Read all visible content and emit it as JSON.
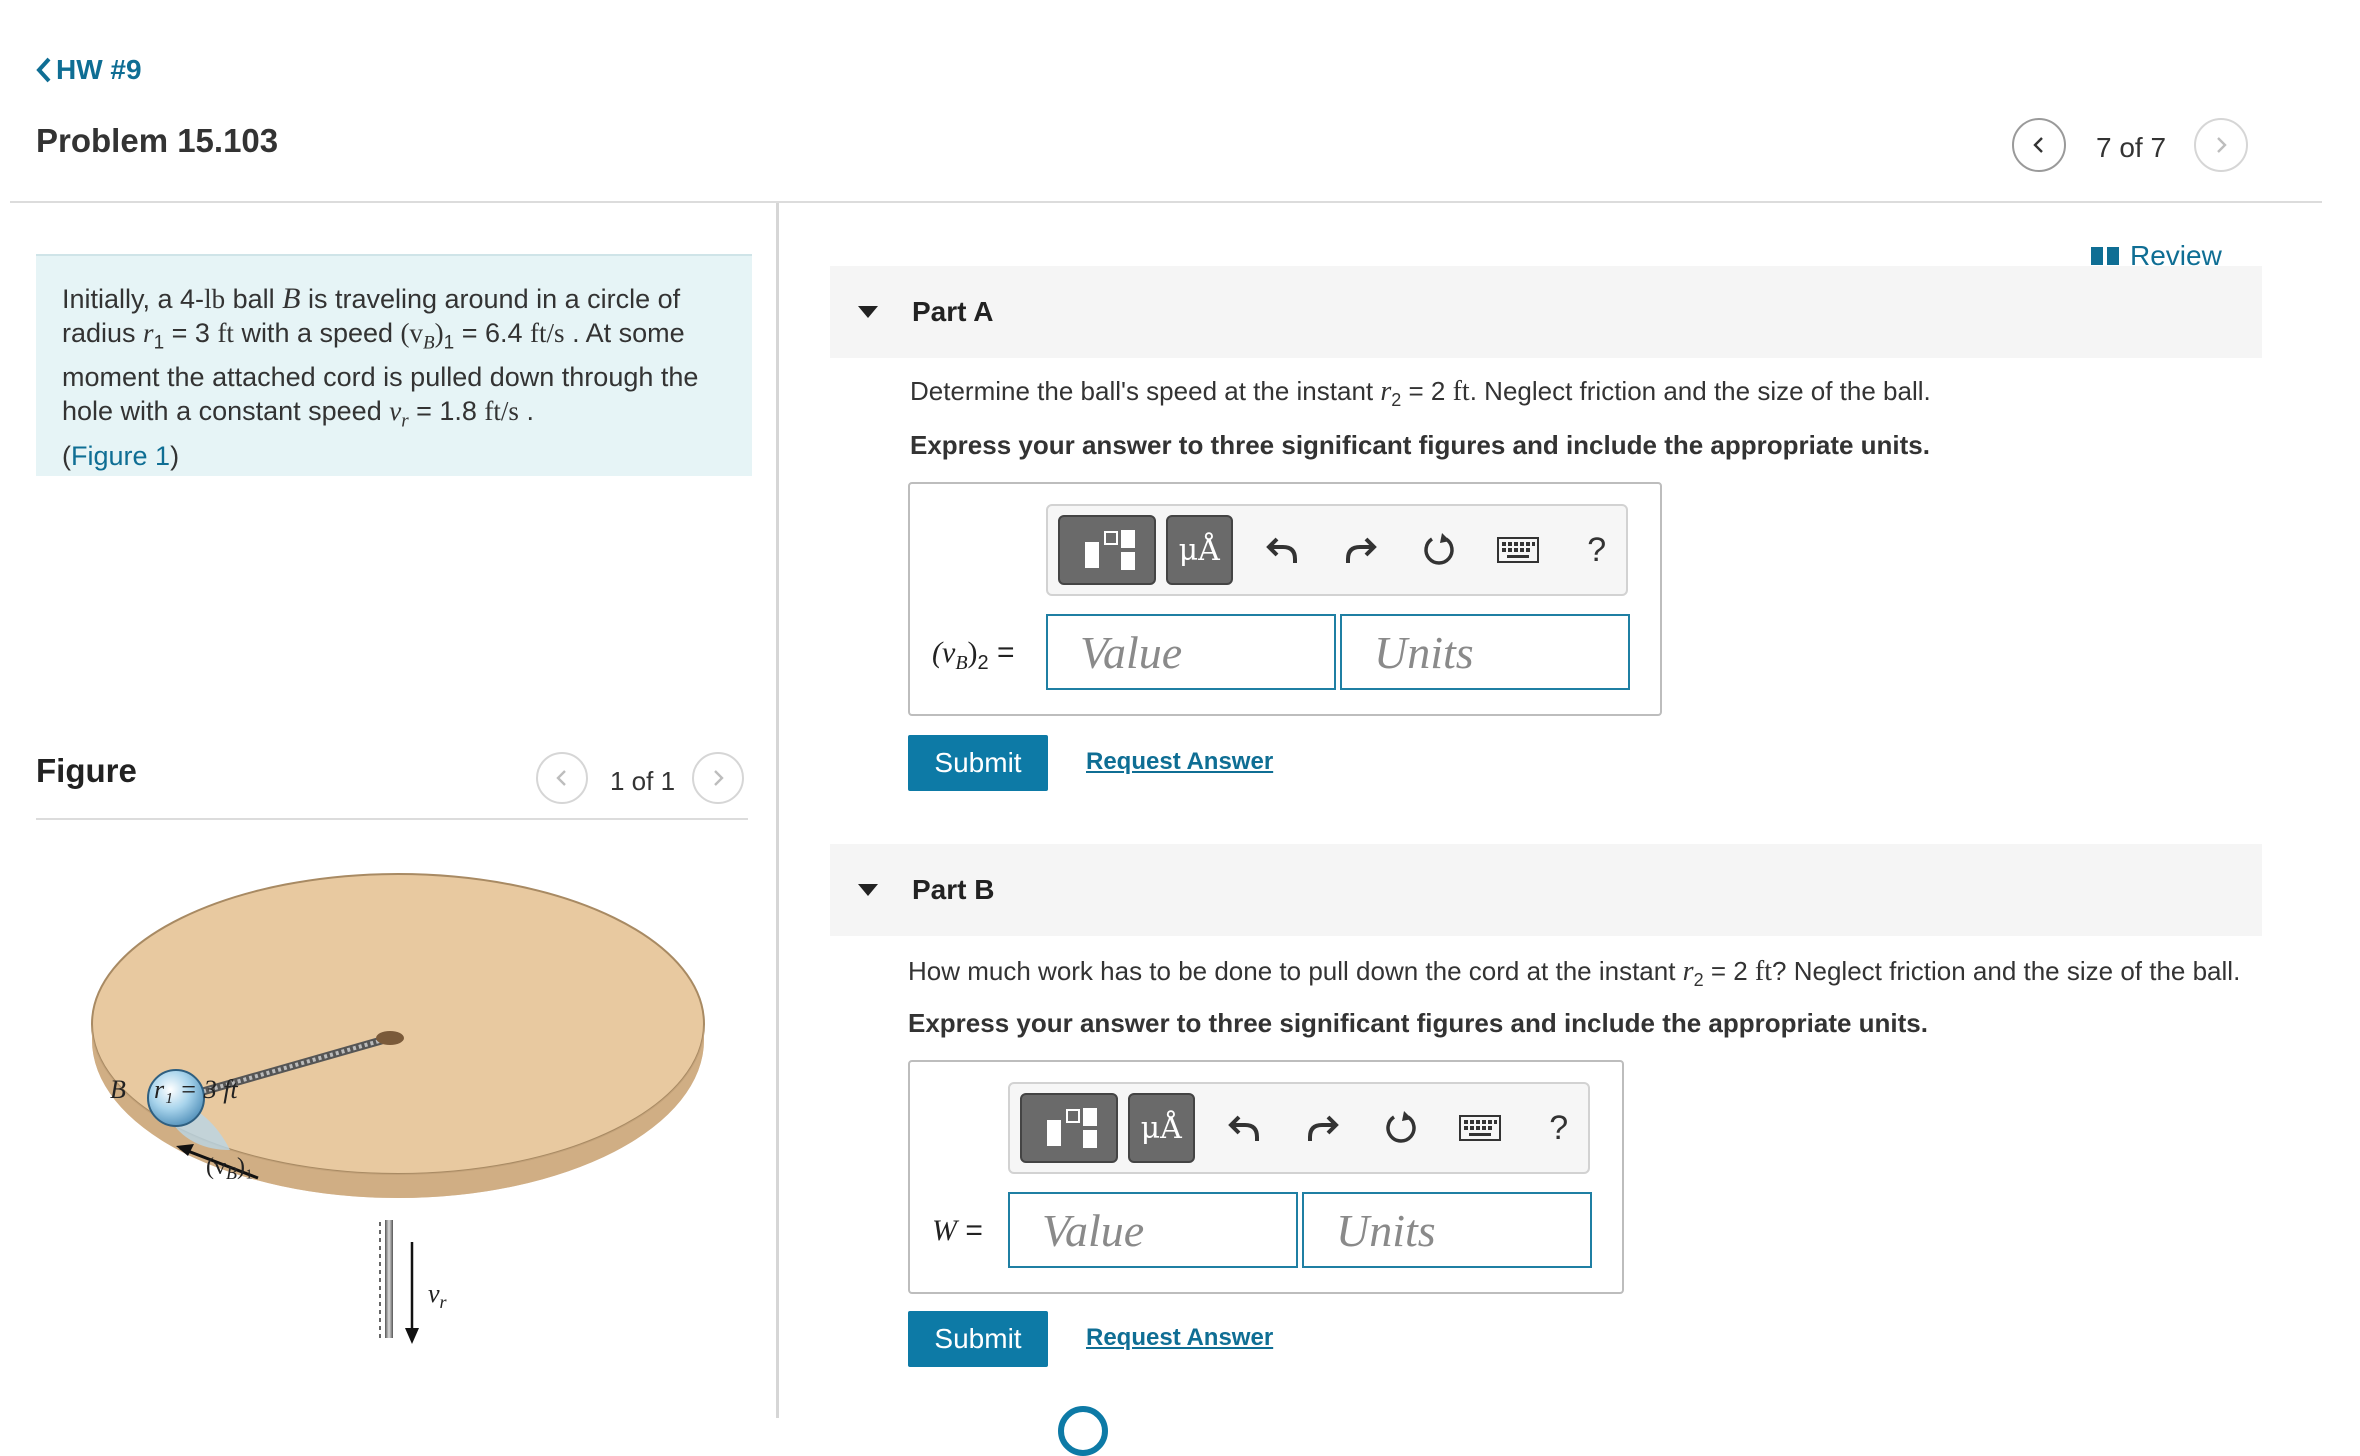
{
  "nav": {
    "back_label": "HW #9"
  },
  "problem": {
    "title": "Problem 15.103",
    "counter": "7 of 7"
  },
  "statement": {
    "line1_pre": "Initially, a 4-",
    "line1_unit": "lb",
    "line1_mid": " ball ",
    "line1_var": "B",
    "line1_post": " is traveling around in a circle of",
    "line2_pre": "radius ",
    "line2_var": "r",
    "line2_sub": "1",
    "line2_eq": " = 3 ",
    "line2_unit": "ft",
    "line2_mid": " with a speed ",
    "line2_speed": "(v",
    "line2_speed_sub": "B",
    "line2_speed_close": ")",
    "line2_speed_idx": "1",
    "line2_val": " = 6.4 ",
    "line2_val_unit": "ft/s",
    "line2_post": " . At some",
    "line3": "moment the attached cord is pulled down through the",
    "line4_pre": "hole with a constant speed ",
    "line4_var": "v",
    "line4_sub": "r",
    "line4_val": " = 1.8 ",
    "line4_unit": "ft/s",
    "line4_post": " .",
    "figure_open": "(",
    "figure_link": "Figure 1",
    "figure_close": ")"
  },
  "figure": {
    "heading": "Figure",
    "counter": "1 of 1",
    "labels": {
      "b": "B",
      "r1": "r₁ = 3 ft",
      "vb": "(v",
      "vb_sub": "B",
      "vb_close": ")₁",
      "vr": "v",
      "vr_sub": "r"
    }
  },
  "review": {
    "label": "Review"
  },
  "parts": [
    {
      "label": "Part A",
      "question_pre": "Determine the ball's speed at the instant ",
      "question_var": "r",
      "question_sub": "2",
      "question_eq": " = 2 ",
      "question_unit": "ft",
      "question_post": ". Neglect friction and the size of the ball.",
      "instructions": "Express your answer to three significant figures and include the appropriate units.",
      "field_label": "(v",
      "field_sub": "B",
      "field_close": ")",
      "field_idx": "2",
      "field_eq": " =",
      "value_placeholder": "Value",
      "units_placeholder": "Units",
      "submit": "Submit",
      "request": "Request Answer"
    },
    {
      "label": "Part B",
      "question_pre": "How much work has to be done to pull down the cord at the instant ",
      "question_var": "r",
      "question_sub": "2",
      "question_eq": " = 2 ",
      "question_unit": "ft",
      "question_post": "? Neglect friction and the size of the ball.",
      "instructions": "Express your answer to three significant figures and include the appropriate units.",
      "field_label": "W",
      "field_eq": " =",
      "value_placeholder": "Value",
      "units_placeholder": "Units",
      "submit": "Submit",
      "request": "Request Answer"
    }
  ],
  "toolbar": {
    "mu_label": "μÅ",
    "help_label": "?",
    "icons": [
      "templates-icon",
      "units-icon",
      "undo-icon",
      "redo-icon",
      "reset-icon",
      "keyboard-icon",
      "help-icon"
    ]
  },
  "colors": {
    "accent": "#0f6e94",
    "submit": "#0d7aa6",
    "problem_bg": "#e6f4f6",
    "part_header_bg": "#f5f5f5",
    "tabletop": "#e8c9a0"
  }
}
